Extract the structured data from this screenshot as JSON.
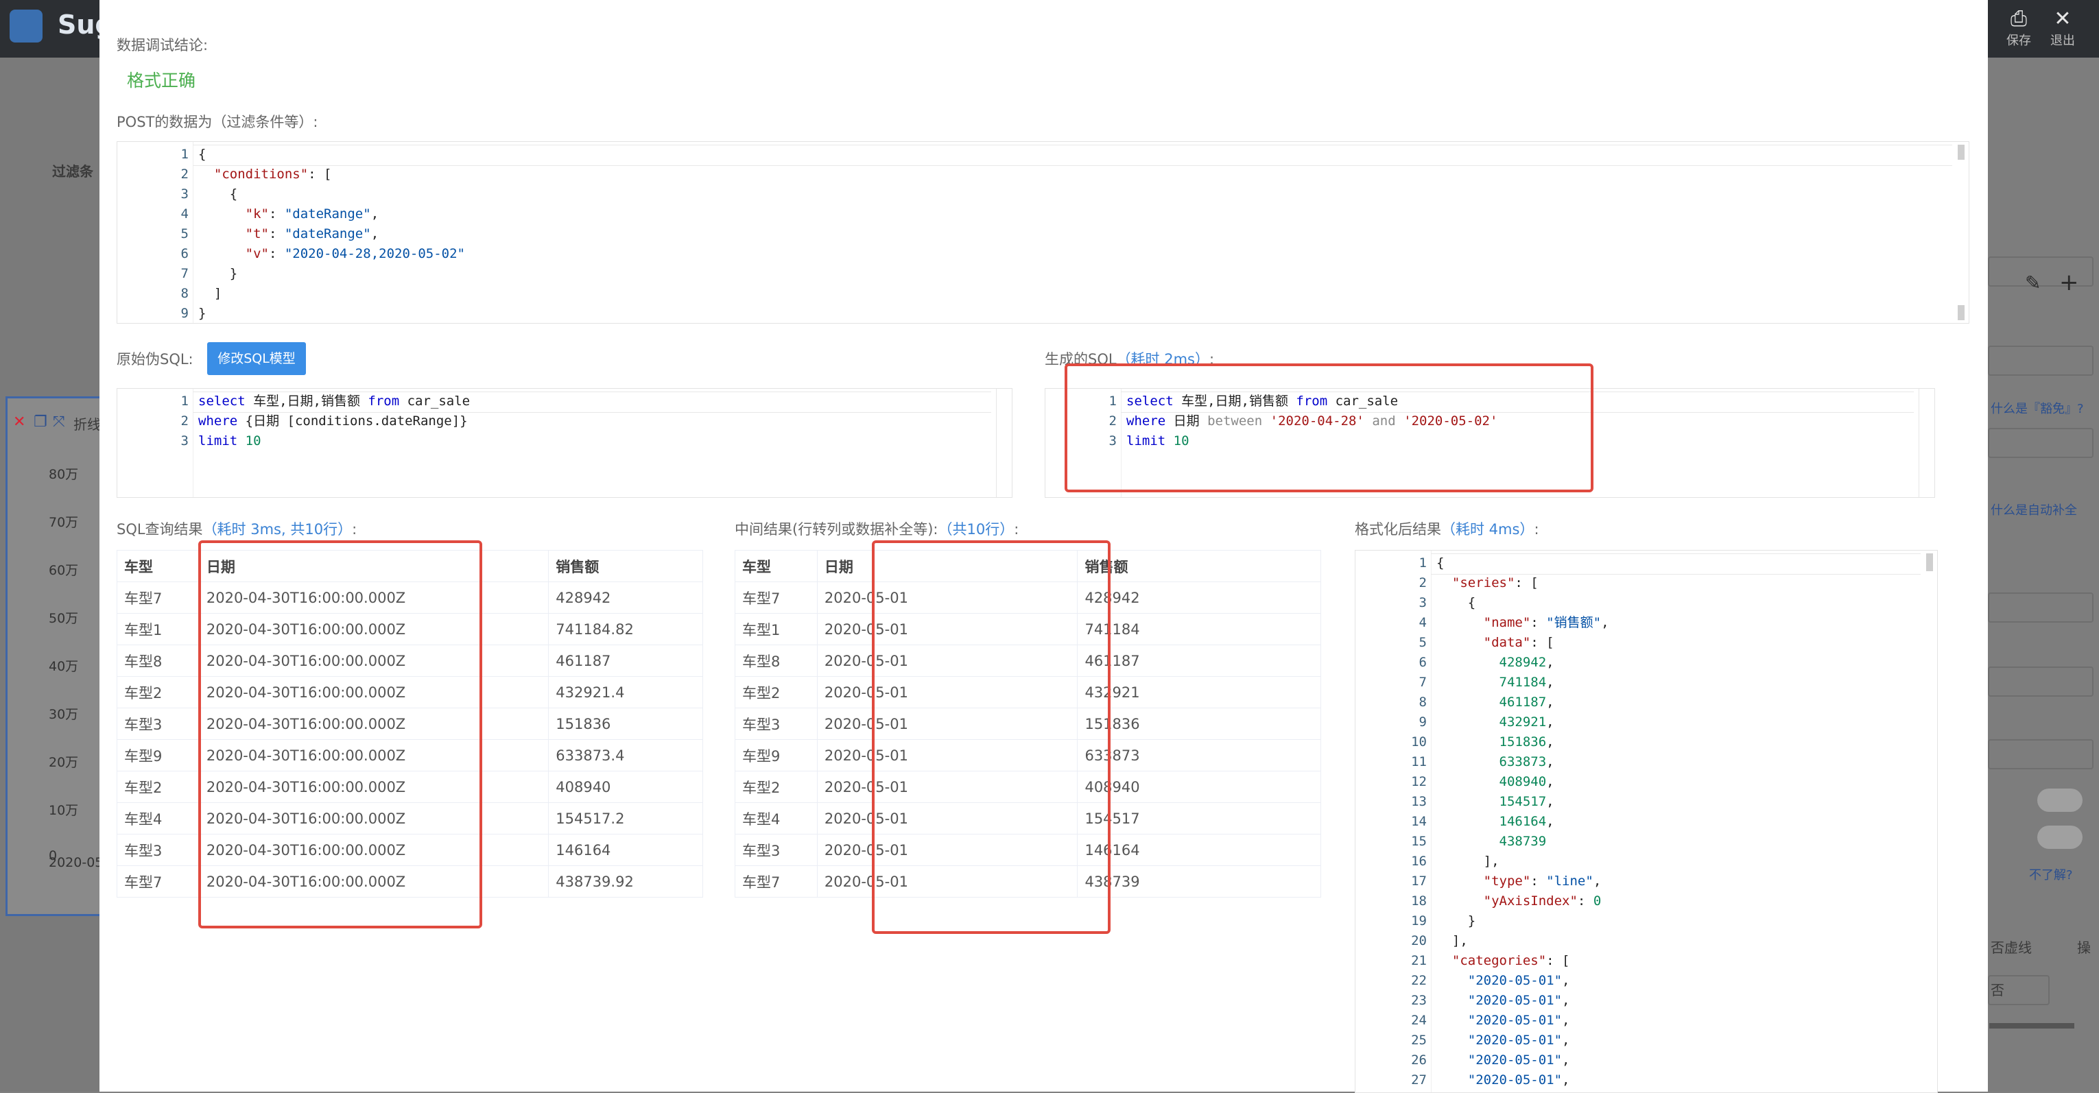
{
  "app": {
    "logo_text": "Sug",
    "save_label": "保存",
    "exit_label": "退出",
    "filter_label": "过滤条",
    "chart_tab_label": "折线",
    "y_ticks": [
      "80万",
      "70万",
      "60万",
      "50万",
      "40万",
      "30万",
      "20万",
      "10万",
      "0"
    ],
    "x_tick": "2020-05",
    "right_links": [
      "什么是『豁免』?",
      "什么是自动补全",
      "不了解?"
    ],
    "right_labels": [
      "否虚线",
      "操",
      "否"
    ]
  },
  "modal": {
    "conclusion_label": "数据调试结论:",
    "conclusion_value": "格式正确",
    "post_label": "POST的数据为（过滤条件等）:",
    "post_code": [
      [
        {
          "t": "{",
          "c": ""
        }
      ],
      [
        {
          "t": "  ",
          "c": ""
        },
        {
          "t": "\"conditions\"",
          "c": "k-key"
        },
        {
          "t": ": [",
          "c": ""
        }
      ],
      [
        {
          "t": "    {",
          "c": ""
        }
      ],
      [
        {
          "t": "      ",
          "c": ""
        },
        {
          "t": "\"k\"",
          "c": "k-key"
        },
        {
          "t": ": ",
          "c": ""
        },
        {
          "t": "\"dateRange\"",
          "c": "k-str"
        },
        {
          "t": ",",
          "c": ""
        }
      ],
      [
        {
          "t": "      ",
          "c": ""
        },
        {
          "t": "\"t\"",
          "c": "k-key"
        },
        {
          "t": ": ",
          "c": ""
        },
        {
          "t": "\"dateRange\"",
          "c": "k-str"
        },
        {
          "t": ",",
          "c": ""
        }
      ],
      [
        {
          "t": "      ",
          "c": ""
        },
        {
          "t": "\"v\"",
          "c": "k-key"
        },
        {
          "t": ": ",
          "c": ""
        },
        {
          "t": "\"2020-04-28,2020-05-02\"",
          "c": "k-str"
        }
      ],
      [
        {
          "t": "    }",
          "c": ""
        }
      ],
      [
        {
          "t": "  ]",
          "c": ""
        }
      ],
      [
        {
          "t": "}",
          "c": ""
        }
      ]
    ],
    "orig_sql_label": "原始伪SQL:",
    "edit_sql_button": "修改SQL模型",
    "orig_sql_code": [
      [
        {
          "t": "select",
          "c": "k-kw"
        },
        {
          "t": " 车型,日期,销售额 ",
          "c": ""
        },
        {
          "t": "from",
          "c": "k-kw"
        },
        {
          "t": " car_sale",
          "c": ""
        }
      ],
      [
        {
          "t": "where",
          "c": "k-kw"
        },
        {
          "t": " {日期 [conditions.dateRange]}",
          "c": ""
        }
      ],
      [
        {
          "t": "limit",
          "c": "k-kw"
        },
        {
          "t": " ",
          "c": ""
        },
        {
          "t": "10",
          "c": "k-num"
        }
      ]
    ],
    "gen_sql_label": "生成的SQL",
    "gen_sql_time": "（耗时 2ms）",
    "gen_sql_colon": ":",
    "gen_sql_code": [
      [
        {
          "t": "select",
          "c": "k-kw"
        },
        {
          "t": " 车型,日期,销售额 ",
          "c": ""
        },
        {
          "t": "from",
          "c": "k-kw"
        },
        {
          "t": " car_sale",
          "c": ""
        }
      ],
      [
        {
          "t": "where",
          "c": "k-kw"
        },
        {
          "t": " 日期 ",
          "c": ""
        },
        {
          "t": "between",
          "c": "k-gray"
        },
        {
          "t": " ",
          "c": ""
        },
        {
          "t": "'2020-04-28'",
          "c": "k-red"
        },
        {
          "t": " ",
          "c": ""
        },
        {
          "t": "and",
          "c": "k-gray"
        },
        {
          "t": " ",
          "c": ""
        },
        {
          "t": "'2020-05-02'",
          "c": "k-red"
        }
      ],
      [
        {
          "t": "limit",
          "c": "k-kw"
        },
        {
          "t": " ",
          "c": ""
        },
        {
          "t": "10",
          "c": "k-num"
        }
      ]
    ],
    "sql_result_label": "SQL查询结果",
    "sql_result_time": "（耗时 3ms, 共10行）",
    "sql_result_colon": ":",
    "sql_table": {
      "headers": [
        "车型",
        "日期",
        "销售额"
      ],
      "rows": [
        [
          "车型7",
          "2020-04-30T16:00:00.000Z",
          "428942"
        ],
        [
          "车型1",
          "2020-04-30T16:00:00.000Z",
          "741184.82"
        ],
        [
          "车型8",
          "2020-04-30T16:00:00.000Z",
          "461187"
        ],
        [
          "车型2",
          "2020-04-30T16:00:00.000Z",
          "432921.4"
        ],
        [
          "车型3",
          "2020-04-30T16:00:00.000Z",
          "151836"
        ],
        [
          "车型9",
          "2020-04-30T16:00:00.000Z",
          "633873.4"
        ],
        [
          "车型2",
          "2020-04-30T16:00:00.000Z",
          "408940"
        ],
        [
          "车型4",
          "2020-04-30T16:00:00.000Z",
          "154517.2"
        ],
        [
          "车型3",
          "2020-04-30T16:00:00.000Z",
          "146164"
        ],
        [
          "车型7",
          "2020-04-30T16:00:00.000Z",
          "438739.92"
        ]
      ]
    },
    "mid_result_label": "中间结果(行转列或数据补全等):",
    "mid_result_time": "（共10行）",
    "mid_result_colon": ":",
    "mid_table": {
      "headers": [
        "车型",
        "日期",
        "销售额"
      ],
      "rows": [
        [
          "车型7",
          "2020-05-01",
          "428942"
        ],
        [
          "车型1",
          "2020-05-01",
          "741184"
        ],
        [
          "车型8",
          "2020-05-01",
          "461187"
        ],
        [
          "车型2",
          "2020-05-01",
          "432921"
        ],
        [
          "车型3",
          "2020-05-01",
          "151836"
        ],
        [
          "车型9",
          "2020-05-01",
          "633873"
        ],
        [
          "车型2",
          "2020-05-01",
          "408940"
        ],
        [
          "车型4",
          "2020-05-01",
          "154517"
        ],
        [
          "车型3",
          "2020-05-01",
          "146164"
        ],
        [
          "车型7",
          "2020-05-01",
          "438739"
        ]
      ]
    },
    "fmt_result_label": "格式化后结果",
    "fmt_result_time": "（耗时 4ms）",
    "fmt_result_colon": ":",
    "fmt_code": [
      [
        {
          "t": "{",
          "c": ""
        }
      ],
      [
        {
          "t": "  ",
          "c": ""
        },
        {
          "t": "\"series\"",
          "c": "k-key"
        },
        {
          "t": ": [",
          "c": ""
        }
      ],
      [
        {
          "t": "    {",
          "c": ""
        }
      ],
      [
        {
          "t": "      ",
          "c": ""
        },
        {
          "t": "\"name\"",
          "c": "k-key"
        },
        {
          "t": ": ",
          "c": ""
        },
        {
          "t": "\"销售额\"",
          "c": "k-str"
        },
        {
          "t": ",",
          "c": ""
        }
      ],
      [
        {
          "t": "      ",
          "c": ""
        },
        {
          "t": "\"data\"",
          "c": "k-key"
        },
        {
          "t": ": [",
          "c": ""
        }
      ],
      [
        {
          "t": "        ",
          "c": ""
        },
        {
          "t": "428942",
          "c": "k-num"
        },
        {
          "t": ",",
          "c": ""
        }
      ],
      [
        {
          "t": "        ",
          "c": ""
        },
        {
          "t": "741184",
          "c": "k-num"
        },
        {
          "t": ",",
          "c": ""
        }
      ],
      [
        {
          "t": "        ",
          "c": ""
        },
        {
          "t": "461187",
          "c": "k-num"
        },
        {
          "t": ",",
          "c": ""
        }
      ],
      [
        {
          "t": "        ",
          "c": ""
        },
        {
          "t": "432921",
          "c": "k-num"
        },
        {
          "t": ",",
          "c": ""
        }
      ],
      [
        {
          "t": "        ",
          "c": ""
        },
        {
          "t": "151836",
          "c": "k-num"
        },
        {
          "t": ",",
          "c": ""
        }
      ],
      [
        {
          "t": "        ",
          "c": ""
        },
        {
          "t": "633873",
          "c": "k-num"
        },
        {
          "t": ",",
          "c": ""
        }
      ],
      [
        {
          "t": "        ",
          "c": ""
        },
        {
          "t": "408940",
          "c": "k-num"
        },
        {
          "t": ",",
          "c": ""
        }
      ],
      [
        {
          "t": "        ",
          "c": ""
        },
        {
          "t": "154517",
          "c": "k-num"
        },
        {
          "t": ",",
          "c": ""
        }
      ],
      [
        {
          "t": "        ",
          "c": ""
        },
        {
          "t": "146164",
          "c": "k-num"
        },
        {
          "t": ",",
          "c": ""
        }
      ],
      [
        {
          "t": "        ",
          "c": ""
        },
        {
          "t": "438739",
          "c": "k-num"
        }
      ],
      [
        {
          "t": "      ],",
          "c": ""
        }
      ],
      [
        {
          "t": "      ",
          "c": ""
        },
        {
          "t": "\"type\"",
          "c": "k-key"
        },
        {
          "t": ": ",
          "c": ""
        },
        {
          "t": "\"line\"",
          "c": "k-str"
        },
        {
          "t": ",",
          "c": ""
        }
      ],
      [
        {
          "t": "      ",
          "c": ""
        },
        {
          "t": "\"yAxisIndex\"",
          "c": "k-key"
        },
        {
          "t": ": ",
          "c": ""
        },
        {
          "t": "0",
          "c": "k-num"
        }
      ],
      [
        {
          "t": "    }",
          "c": ""
        }
      ],
      [
        {
          "t": "  ],",
          "c": ""
        }
      ],
      [
        {
          "t": "  ",
          "c": ""
        },
        {
          "t": "\"categories\"",
          "c": "k-key"
        },
        {
          "t": ": [",
          "c": ""
        }
      ],
      [
        {
          "t": "    ",
          "c": ""
        },
        {
          "t": "\"2020-05-01\"",
          "c": "k-str"
        },
        {
          "t": ",",
          "c": ""
        }
      ],
      [
        {
          "t": "    ",
          "c": ""
        },
        {
          "t": "\"2020-05-01\"",
          "c": "k-str"
        },
        {
          "t": ",",
          "c": ""
        }
      ],
      [
        {
          "t": "    ",
          "c": ""
        },
        {
          "t": "\"2020-05-01\"",
          "c": "k-str"
        },
        {
          "t": ",",
          "c": ""
        }
      ],
      [
        {
          "t": "    ",
          "c": ""
        },
        {
          "t": "\"2020-05-01\"",
          "c": "k-str"
        },
        {
          "t": ",",
          "c": ""
        }
      ],
      [
        {
          "t": "    ",
          "c": ""
        },
        {
          "t": "\"2020-05-01\"",
          "c": "k-str"
        },
        {
          "t": ",",
          "c": ""
        }
      ],
      [
        {
          "t": "    ",
          "c": ""
        },
        {
          "t": "\"2020-05-01\"",
          "c": "k-str"
        },
        {
          "t": ",",
          "c": ""
        }
      ]
    ]
  }
}
